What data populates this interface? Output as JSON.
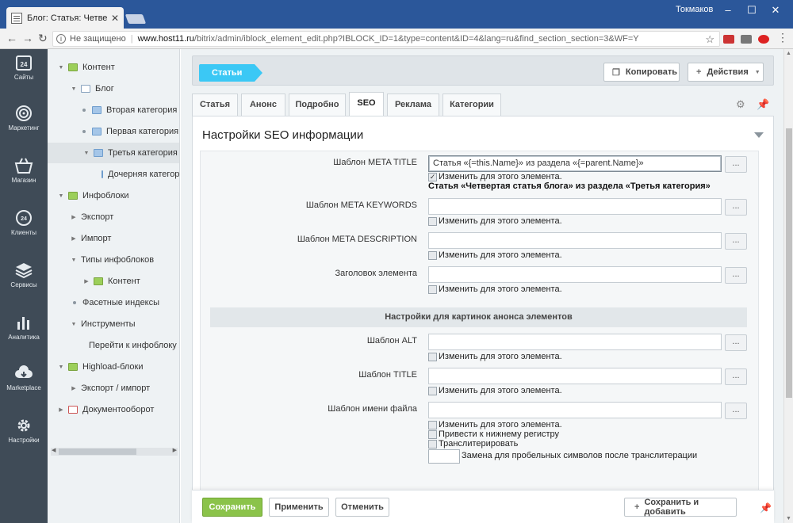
{
  "browser": {
    "tab_title": "Блог: Статья: Четвертая",
    "user": "Токмаков",
    "security_label": "Не защищено",
    "url_host": "www.host11.ru",
    "url_path": "/bitrix/admin/iblock_element_edit.php?IBLOCK_ID=1&type=content&ID=4&lang=ru&find_section_section=3&WF=Y"
  },
  "leftnav": {
    "items": [
      {
        "label": "Сайты",
        "icon": "calendar-24-icon"
      },
      {
        "label": "Маркетинг",
        "icon": "target-icon"
      },
      {
        "label": "Магазин",
        "icon": "basket-icon"
      },
      {
        "label": "Клиенты",
        "icon": "bubble-24-icon"
      },
      {
        "label": "Сервисы",
        "icon": "layers-icon"
      },
      {
        "label": "Аналитика",
        "icon": "bar-chart-icon"
      },
      {
        "label": "Marketplace",
        "icon": "cloud-download-icon"
      },
      {
        "label": "Настройки",
        "icon": "gear-icon"
      }
    ]
  },
  "tree": {
    "items": [
      {
        "label": "Контент"
      },
      {
        "label": "Блог"
      },
      {
        "label": "Вторая категория"
      },
      {
        "label": "Первая категория"
      },
      {
        "label": "Третья категория"
      },
      {
        "label": "Дочерняя категория"
      },
      {
        "label": "Инфоблоки"
      },
      {
        "label": "Экспорт"
      },
      {
        "label": "Импорт"
      },
      {
        "label": "Типы инфоблоков"
      },
      {
        "label": "Контент"
      },
      {
        "label": "Фасетные индексы"
      },
      {
        "label": "Инструменты"
      },
      {
        "label": "Перейти к инфоблоку / разделу"
      },
      {
        "label": "Highload-блоки"
      },
      {
        "label": "Экспорт / импорт"
      },
      {
        "label": "Документооборот"
      }
    ]
  },
  "toolbar": {
    "breadcrumb": "Статьи",
    "copy_label": "Копировать",
    "actions_label": "Действия"
  },
  "tabs": [
    "Статья",
    "Анонс",
    "Подробно",
    "SEO",
    "Реклама",
    "Категории"
  ],
  "active_tab": "SEO",
  "panel": {
    "title": "Настройки SEO информации",
    "fields": [
      {
        "label": "Шаблон META TITLE",
        "value": "Статья «{=this.Name}» из раздела «{=parent.Name}»",
        "checkbox": "Изменить для этого элемента.",
        "preview": "Статья «Четвертая статья блога» из раздела «Третья категория»"
      },
      {
        "label": "Шаблон META KEYWORDS",
        "value": "",
        "checkbox": "Изменить для этого элемента."
      },
      {
        "label": "Шаблон META DESCRIPTION",
        "value": "",
        "checkbox": "Изменить для этого элемента."
      },
      {
        "label": "Заголовок элемента",
        "value": "",
        "checkbox": "Изменить для этого элемента."
      }
    ],
    "section_title": "Настройки для картинок анонса элементов",
    "image_fields": [
      {
        "label": "Шаблон ALT",
        "value": "",
        "checkbox": "Изменить для этого элемента."
      },
      {
        "label": "Шаблон TITLE",
        "value": "",
        "checkbox": "Изменить для этого элемента."
      },
      {
        "label": "Шаблон имени файла",
        "value": "",
        "checkbox": "Изменить для этого элемента."
      }
    ],
    "extra_checkboxes": [
      "Привести к нижнему регистру",
      "Транслитерировать"
    ],
    "space_replace_label": "Замена для пробельных символов после транслитерации",
    "button_dots": "..."
  },
  "footer": {
    "save": "Сохранить",
    "apply": "Применить",
    "cancel": "Отменить",
    "save_add": "Сохранить и добавить"
  },
  "colors": {
    "titlebar": "#2b579a",
    "leftnav": "#3f4b57",
    "breadcrumb": "#3bc8f5",
    "save_green": "#8bc34a"
  }
}
